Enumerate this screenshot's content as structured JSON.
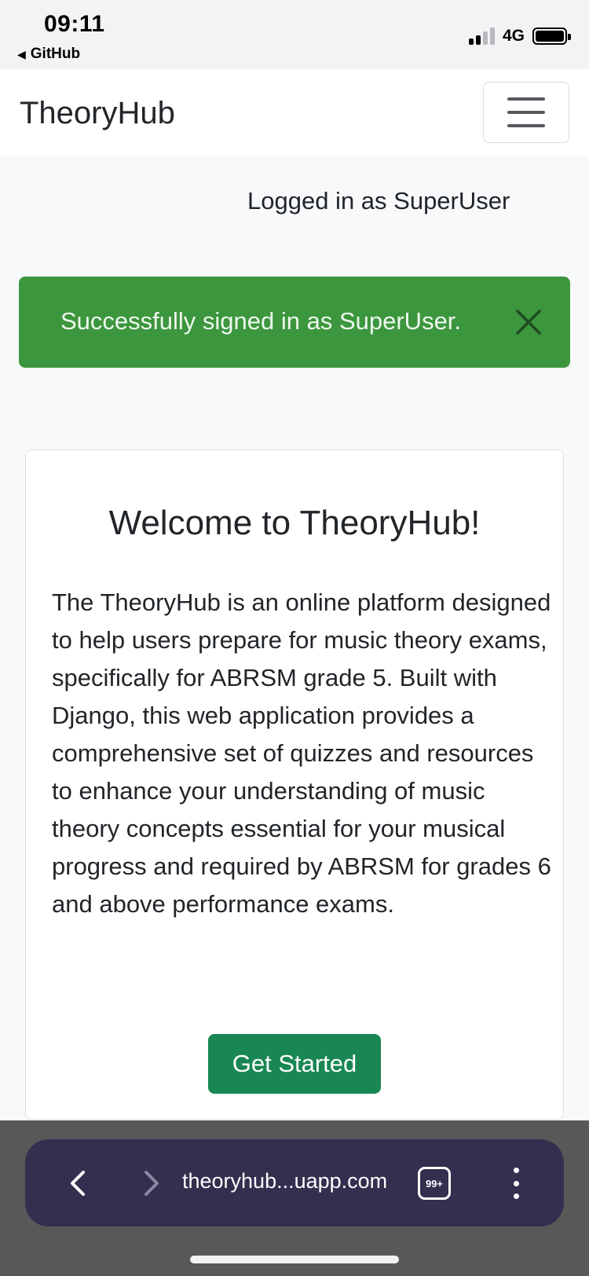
{
  "status_bar": {
    "time": "09:11",
    "back_app": "GitHub",
    "network": "4G",
    "signal_bars_filled": 2,
    "signal_bars_total": 4,
    "battery_level": 1.0
  },
  "navbar": {
    "brand": "TheoryHub",
    "menu_icon": "hamburger-menu-icon"
  },
  "user_status": "Logged in as SuperUser",
  "alert": {
    "message": "Successfully signed in as SuperUser.",
    "color": "#3c963d",
    "close_icon": "close-icon"
  },
  "card": {
    "title": "Welcome to TheoryHub!",
    "body": "The TheoryHub is an online platform designed to help users prepare for music theory exams, specifically for ABRSM grade 5. Built with Django, this web application provides a comprehensive set of quizzes and resources to enhance your understanding of music theory concepts essential for your musical progress and required by ABRSM for grades 6 and above performance exams.",
    "cta_label": "Get Started",
    "cta_color": "#198754"
  },
  "browser": {
    "url": "theoryhub...uapp.com",
    "tab_count": "99+",
    "back_icon": "chevron-left-icon",
    "forward_icon": "chevron-right-icon",
    "more_icon": "more-vertical-icon"
  }
}
